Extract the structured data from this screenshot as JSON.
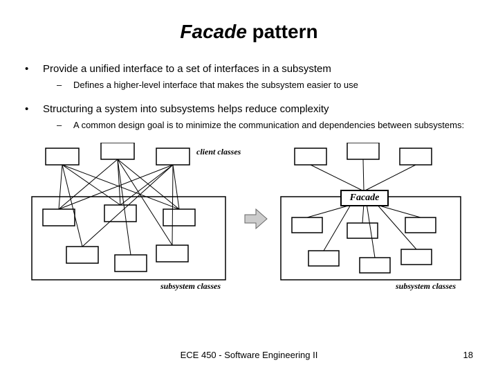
{
  "title": {
    "italic": "Facade",
    "rest": " pattern"
  },
  "bullets": [
    {
      "text": "Provide a unified interface to a set of interfaces in a subsystem",
      "sub": "Defines a higher-level interface that makes the subsystem easier to use"
    },
    {
      "text": "Structuring a system into subsystems helps reduce complexity",
      "sub": "A common design goal is to minimize the communication and dependencies between subsystems:"
    }
  ],
  "labels": {
    "client": "client classes",
    "subsystem": "subsystem classes",
    "facade": "Facade"
  },
  "footer": {
    "center": "ECE 450 - Software Engineering II",
    "page": "18"
  }
}
